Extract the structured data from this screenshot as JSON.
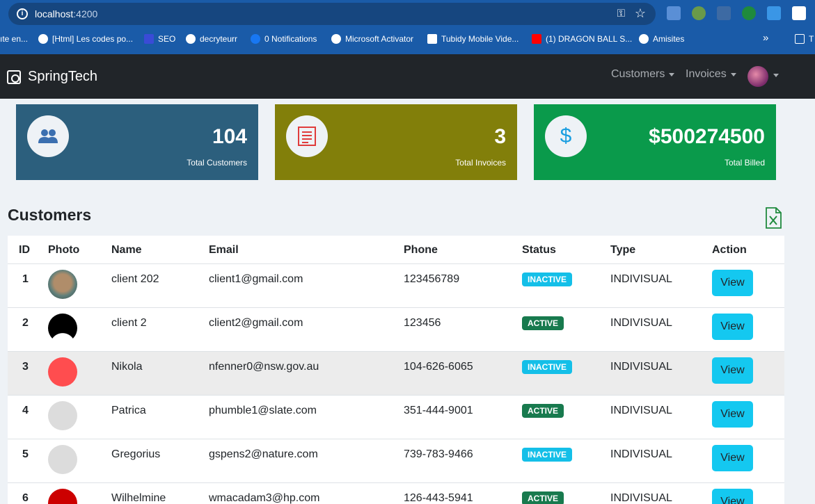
{
  "browser": {
    "url_host": "localhost",
    "url_port": ":4200",
    "bookmarks": [
      {
        "label": "ıte en..."
      },
      {
        "label": "[Html] Les codes po..."
      },
      {
        "label": "SEO"
      },
      {
        "label": "decryteurr"
      },
      {
        "label": "0 Notifications"
      },
      {
        "label": "Microsoft Activator"
      },
      {
        "label": "Tubidy Mobile Vide..."
      },
      {
        "label": "(1) DRAGON BALL S..."
      },
      {
        "label": "Amisites"
      },
      {
        "label": "»"
      },
      {
        "label": "T"
      }
    ]
  },
  "navbar": {
    "brand": "SpringTech",
    "customers_label": "Customers",
    "invoices_label": "Invoices"
  },
  "stats": [
    {
      "value": "104",
      "label": "Total Customers",
      "color": "#2c5f7d",
      "icon": "users-icon"
    },
    {
      "value": "3",
      "label": "Total Invoices",
      "color": "#827f0a",
      "icon": "invoice-icon"
    },
    {
      "value": "$500274500",
      "label": "Total Billed",
      "color": "#0a9a4b",
      "icon": "dollar-icon"
    }
  ],
  "customers": {
    "title": "Customers",
    "columns": [
      "ID",
      "Photo",
      "Name",
      "Email",
      "Phone",
      "Status",
      "Type",
      "Action"
    ],
    "rows": [
      {
        "id": "1",
        "name": "client 202",
        "email": "client1@gmail.com",
        "phone": "123456789",
        "status": "INACTIVE",
        "type": "INDIVISUAL",
        "action": "View",
        "photo": "avatar-photo"
      },
      {
        "id": "2",
        "name": "client 2",
        "email": "client2@gmail.com",
        "phone": "123456",
        "status": "ACTIVE",
        "type": "INDIVISUAL",
        "action": "View",
        "photo": "avatar-photo"
      },
      {
        "id": "3",
        "name": "Nikola",
        "email": "nfenner0@nsw.gov.au",
        "phone": "104-626-6065",
        "status": "INACTIVE",
        "type": "INDIVISUAL",
        "action": "View",
        "photo": "placeholder-image"
      },
      {
        "id": "4",
        "name": "Patrica",
        "email": "phumble1@slate.com",
        "phone": "351-444-9001",
        "status": "ACTIVE",
        "type": "INDIVISUAL",
        "action": "View",
        "photo": "placeholder-image"
      },
      {
        "id": "5",
        "name": "Gregorius",
        "email": "gspens2@nature.com",
        "phone": "739-783-9466",
        "status": "INACTIVE",
        "type": "INDIVISUAL",
        "action": "View",
        "photo": "placeholder-image"
      },
      {
        "id": "6",
        "name": "Wilhelmine",
        "email": "wmacadam3@hp.com",
        "phone": "126-443-5941",
        "status": "ACTIVE",
        "type": "INDIVISUAL",
        "action": "View",
        "photo": "placeholder-image"
      }
    ]
  }
}
